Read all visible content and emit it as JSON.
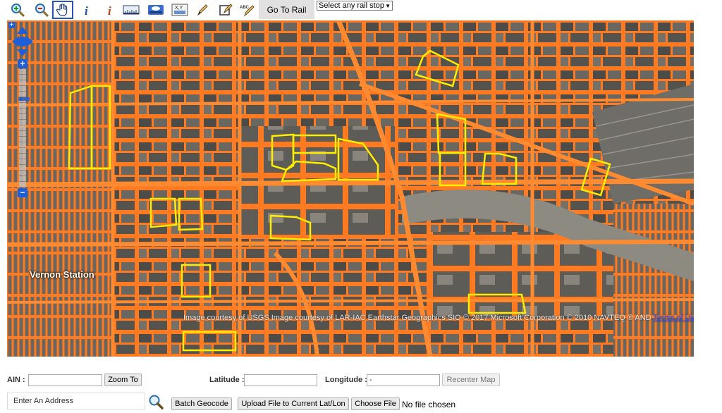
{
  "toolbar": {
    "tools": [
      {
        "name": "zoom-in-icon",
        "active": false
      },
      {
        "name": "zoom-out-icon",
        "active": false
      },
      {
        "name": "pan-hand-icon",
        "active": true
      },
      {
        "name": "info-icon",
        "active": false
      },
      {
        "name": "identify-icon",
        "active": false
      },
      {
        "name": "measure-ruler-icon",
        "active": false
      },
      {
        "name": "layers-icon",
        "active": false
      },
      {
        "name": "xy-coordinate-icon",
        "active": false
      },
      {
        "name": "draw-pen-icon",
        "active": false
      },
      {
        "name": "draw-polygon-icon",
        "active": false
      },
      {
        "name": "annotation-text-icon",
        "active": false
      }
    ],
    "go_to_rail_label": "Go To Rail",
    "rail_select_value": "Select any rail stop"
  },
  "map": {
    "station_label": "Vernon Station",
    "attribution": "Image courtesy of USGS Image courtesy of LAR-IAC Earthstar Geographics SIO © 2017 Microsoft Corporation © 2010 NAVTEQ © AND",
    "terms_link": "Terms of Use",
    "zoom_in": "+",
    "zoom_out": "−",
    "colors": {
      "parcel": "#ff7a20",
      "highlight": "#ffee00",
      "ground": "#5a5852"
    }
  },
  "bottom": {
    "ain_label": "AIN :",
    "ain_value": "",
    "zoom_to_label": "Zoom To",
    "latitude_label": "Latitude :",
    "latitude_value": "",
    "longitude_label": "Longitude :",
    "longitude_value": "-",
    "recenter_label": "Recenter Map",
    "address_placeholder": "Enter An Address",
    "batch_geocode_label": "Batch Geocode",
    "upload_label": "Upload File to Current Lat/Lon",
    "choose_file_label": "Choose File",
    "no_file_label": "No file chosen"
  }
}
